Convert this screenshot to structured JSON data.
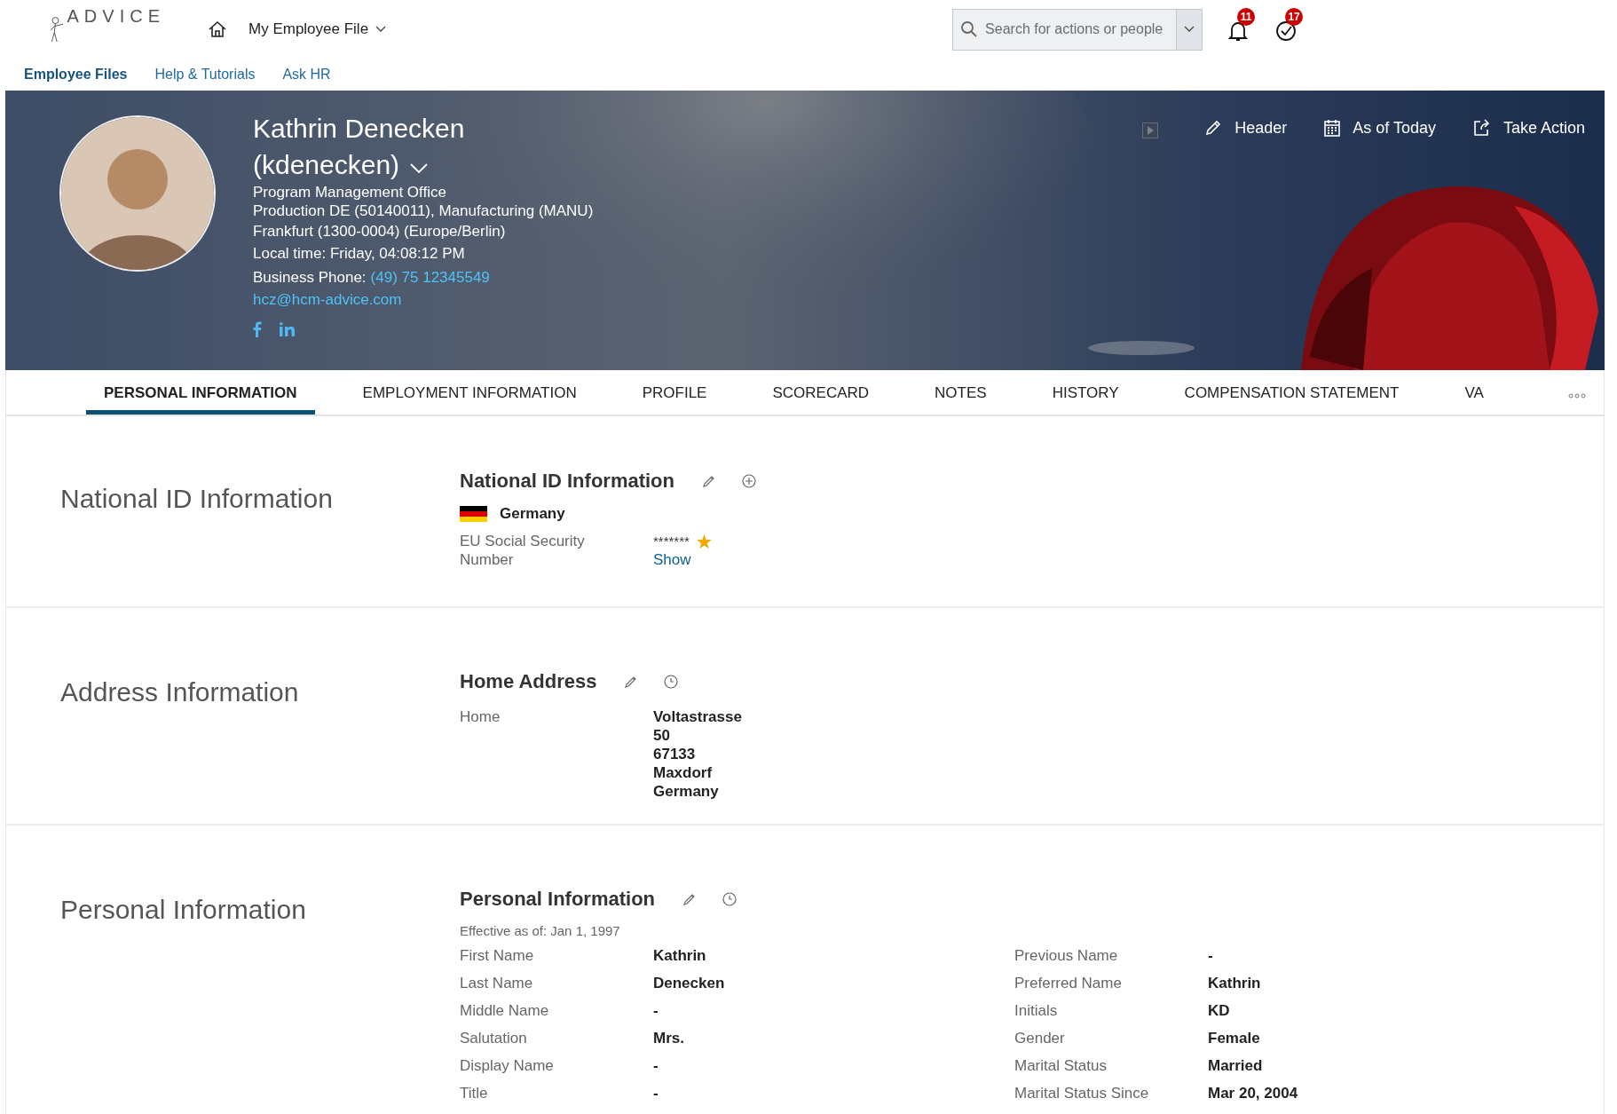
{
  "top_bar": {
    "logo_text": "ADVICE",
    "menu_label": "My Employee File",
    "search": {
      "placeholder": "Search for actions or people"
    },
    "notification_count": "11",
    "task_count": "17"
  },
  "nav_links": [
    {
      "label": "Employee Files",
      "selected": true
    },
    {
      "label": "Help & Tutorials",
      "selected": false
    },
    {
      "label": "Ask HR",
      "selected": false
    }
  ],
  "header": {
    "name": "Kathrin Denecken",
    "username": "(kdenecken)",
    "lines": [
      "Program Management Office",
      "Production DE (50140011), Manufacturing (MANU)",
      "Frankfurt (1300-0004) (Europe/Berlin)",
      "Local time: Friday, 04:08:12 PM"
    ],
    "phone_label": "Business Phone:",
    "phone": "(49) 75 12345549",
    "email": "hcz@hcm-advice.com",
    "actions": [
      {
        "label": "Header",
        "kind": "edit"
      },
      {
        "label": "As of Today",
        "kind": "calendar"
      },
      {
        "label": "Take Action",
        "kind": "share"
      }
    ]
  },
  "tabs": [
    {
      "label": "PERSONAL INFORMATION",
      "selected": true
    },
    {
      "label": "EMPLOYMENT INFORMATION",
      "selected": false
    },
    {
      "label": "PROFILE",
      "selected": false
    },
    {
      "label": "SCORECARD",
      "selected": false
    },
    {
      "label": "NOTES",
      "selected": false
    },
    {
      "label": "HISTORY",
      "selected": false
    },
    {
      "label": "COMPENSATION STATEMENT",
      "selected": false
    },
    {
      "label": "VA",
      "selected": false
    }
  ],
  "sections": [
    {
      "kind": "national_id",
      "title": "National ID Information",
      "card_title": "National ID Information",
      "country": "Germany",
      "label": "EU Social Security Number",
      "value": "*******",
      "primary": true,
      "link": "Show"
    },
    {
      "kind": "address",
      "title": "Address Information",
      "card_title": "Home Address",
      "label": "Home",
      "lines": [
        "Voltastrasse",
        "50",
        "67133",
        "Maxdorf",
        "Germany"
      ]
    },
    {
      "kind": "personal",
      "title": "Personal Information",
      "card_title": "Personal Information",
      "effective": "Effective as of: Jan 1, 1997",
      "columns": [
        [
          {
            "label": "First Name",
            "value": "Kathrin"
          },
          {
            "label": "Last Name",
            "value": "Denecken"
          },
          {
            "label": "Middle Name",
            "value": "-"
          },
          {
            "label": "Salutation",
            "value": "Mrs."
          },
          {
            "label": "Display Name",
            "value": "-"
          },
          {
            "label": "Title",
            "value": "-"
          }
        ],
        [
          {
            "label": "Previous Name",
            "value": "-"
          },
          {
            "label": "Preferred Name",
            "value": "Kathrin"
          },
          {
            "label": "Initials",
            "value": "KD"
          },
          {
            "label": "Gender",
            "value": "Female"
          },
          {
            "label": "Marital Status",
            "value": "Married"
          },
          {
            "label": "Marital Status Since",
            "value": "Mar 20, 2004"
          }
        ]
      ]
    }
  ]
}
